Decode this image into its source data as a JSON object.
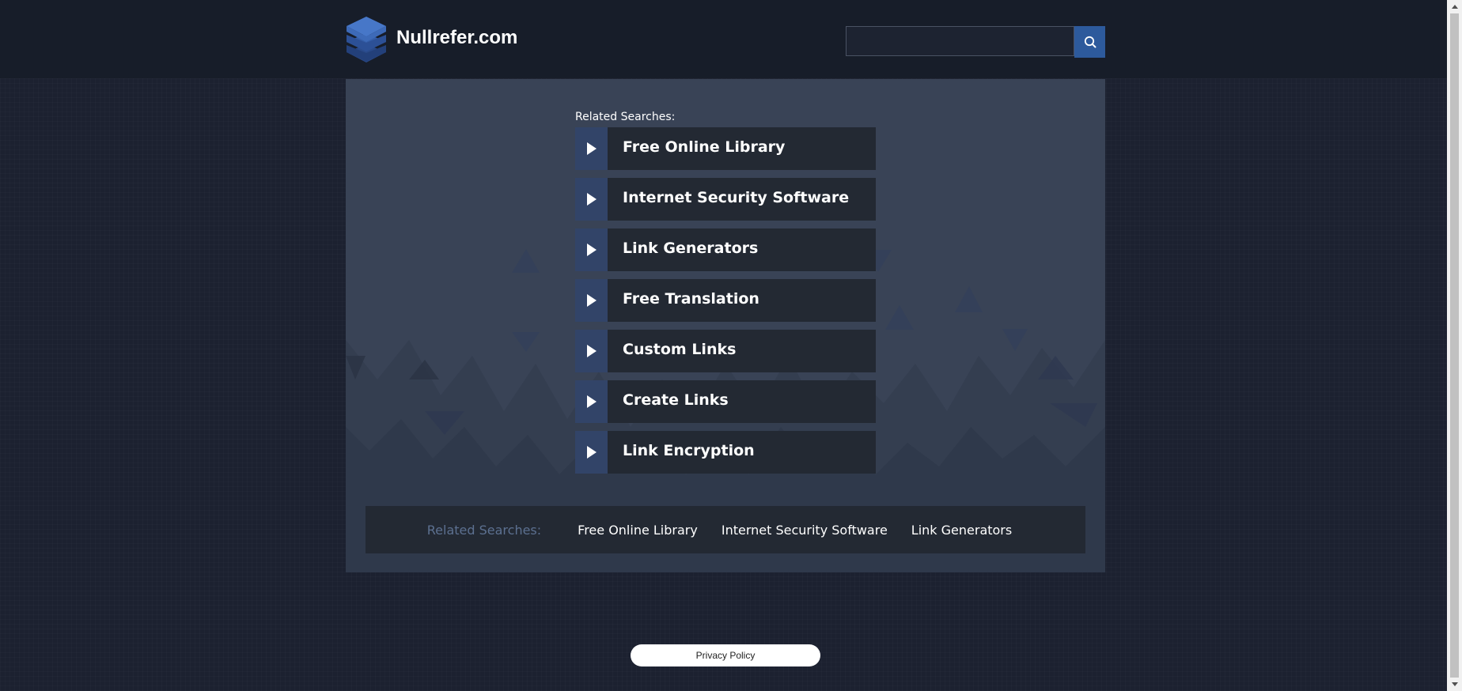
{
  "header": {
    "site_name": "Nullrefer.com",
    "search": {
      "value": "",
      "placeholder": "",
      "button_icon": "search-icon"
    }
  },
  "related_searches": {
    "label": "Related Searches:",
    "items": [
      {
        "label": "Free Online Library"
      },
      {
        "label": "Internet Security Software"
      },
      {
        "label": "Link Generators"
      },
      {
        "label": "Free Translation"
      },
      {
        "label": "Custom Links"
      },
      {
        "label": "Create Links"
      },
      {
        "label": "Link Encryption"
      }
    ]
  },
  "footer_bar": {
    "label": "Related Searches:",
    "links": [
      {
        "label": "Free Online Library"
      },
      {
        "label": "Internet Security Software"
      },
      {
        "label": "Link Generators"
      }
    ]
  },
  "footer": {
    "privacy_label": "Privacy Policy"
  },
  "colors": {
    "page_bg": "#1c2130",
    "header_bg": "#171d29",
    "panel_bg": "#394356",
    "item_bg": "#232933",
    "arrow_bg": "#324468",
    "accent": "#2d5a9c",
    "footer_label": "#5c7090"
  },
  "icons": {
    "logo": "stacked-layers-logo-icon",
    "item_arrow": "play-arrow-icon"
  }
}
